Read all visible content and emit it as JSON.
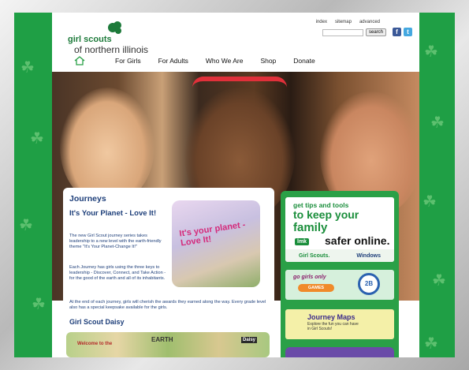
{
  "brand": {
    "line1": "girl scouts",
    "line2": "of northern illinois"
  },
  "utility_links": [
    "index",
    "sitemap",
    "advanced"
  ],
  "search": {
    "button_label": "search",
    "placeholder": ""
  },
  "social": {
    "facebook": "f",
    "twitter": "t"
  },
  "nav": {
    "items": [
      "For Girls",
      "For Adults",
      "Who We Are",
      "Shop",
      "Donate"
    ]
  },
  "content": {
    "heading": "Journeys",
    "subheading": "It's Your Planet - Love It!",
    "para1": "The new Girl Scout journey series takes leadership to a new level with the earth-friendly theme \"It's Your Planet-Change It!\"",
    "para2": "Each Journey has girls using the three keys to leadership - Discover, Connect, and Take Action - for the good of the earth and all of its inhabitants.",
    "para3": "At the end of each journey, girls will cherish the awards they earned along the way. Every grade level also has a special keepsake available for the girls.",
    "section2": "Girl Scout Daisy",
    "journey_art_text": "It's your planet - Love It!",
    "daisy_tags": [
      "Welcome to the",
      "EARTH",
      "Daisy"
    ]
  },
  "sidebar": {
    "ad1": {
      "line1": "get tips and tools",
      "line2": "to keep your",
      "line3": "family",
      "line4": "safer online.",
      "badge": "lmk",
      "partner1": "Girl Scouts.",
      "partner2": "Windows"
    },
    "ad2": {
      "line1": "go girls only",
      "tag": "GAMES",
      "badge": "2B"
    },
    "ad3": {
      "title": "Journey Maps",
      "subtitle": "Explore the fun you can have in Girl Scouts!"
    }
  },
  "colors": {
    "green": "#1f9f45",
    "navy": "#1e3f7a",
    "brand_green": "#1a8e3b"
  }
}
